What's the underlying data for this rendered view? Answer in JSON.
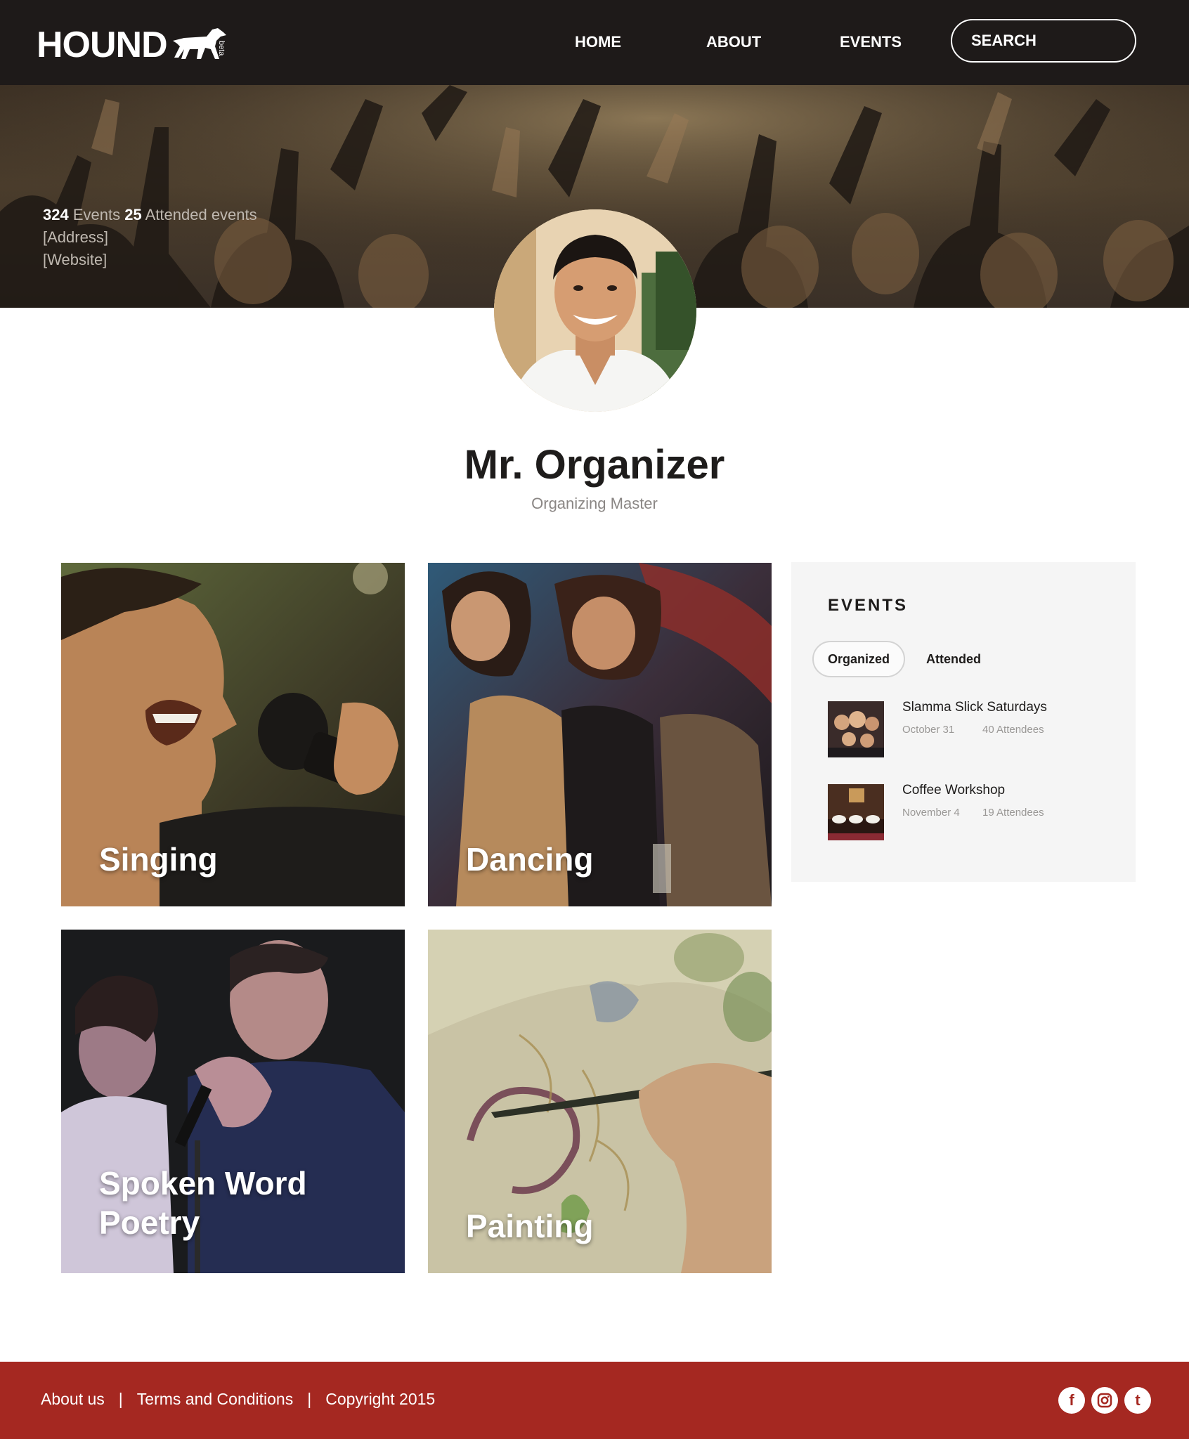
{
  "header": {
    "logo_text": "HOUND",
    "logo_badge": "beta",
    "nav": [
      {
        "label": "HOME"
      },
      {
        "label": "ABOUT"
      },
      {
        "label": "EVENTS"
      }
    ],
    "search_label": "SEARCH"
  },
  "hero": {
    "events_count": "324",
    "events_label": "Events",
    "attended_count": "25",
    "attended_label": "Attended events",
    "address": "[Address]",
    "website": "[Website]"
  },
  "profile": {
    "name": "Mr. Organizer",
    "role": "Organizing Master"
  },
  "categories": [
    {
      "label": "Singing"
    },
    {
      "label": "Dancing"
    },
    {
      "label": "Spoken Word",
      "label2": "Poetry"
    },
    {
      "label": "Painting"
    }
  ],
  "events_panel": {
    "title": "EVENTS",
    "tabs": [
      {
        "label": "Organized",
        "active": true
      },
      {
        "label": "Attended",
        "active": false
      }
    ],
    "items": [
      {
        "title": "Slamma Slick Saturdays",
        "date": "October 31",
        "attendees": "40 Attendees"
      },
      {
        "title": "Coffee Workshop",
        "date": "November 4",
        "attendees": "19 Attendees"
      }
    ]
  },
  "footer": {
    "links": [
      {
        "label": "About us"
      },
      {
        "label": "Terms and Conditions"
      },
      {
        "label": "Copyright 2015"
      }
    ],
    "separator": "|",
    "social": [
      {
        "icon": "facebook-icon",
        "glyph": "f"
      },
      {
        "icon": "instagram-icon",
        "glyph": "◘"
      },
      {
        "icon": "twitter-icon",
        "glyph": "t"
      }
    ]
  },
  "colors": {
    "header_bg": "#1e1a19",
    "footer_bg": "#a52821",
    "panel_bg": "#f5f5f5"
  }
}
